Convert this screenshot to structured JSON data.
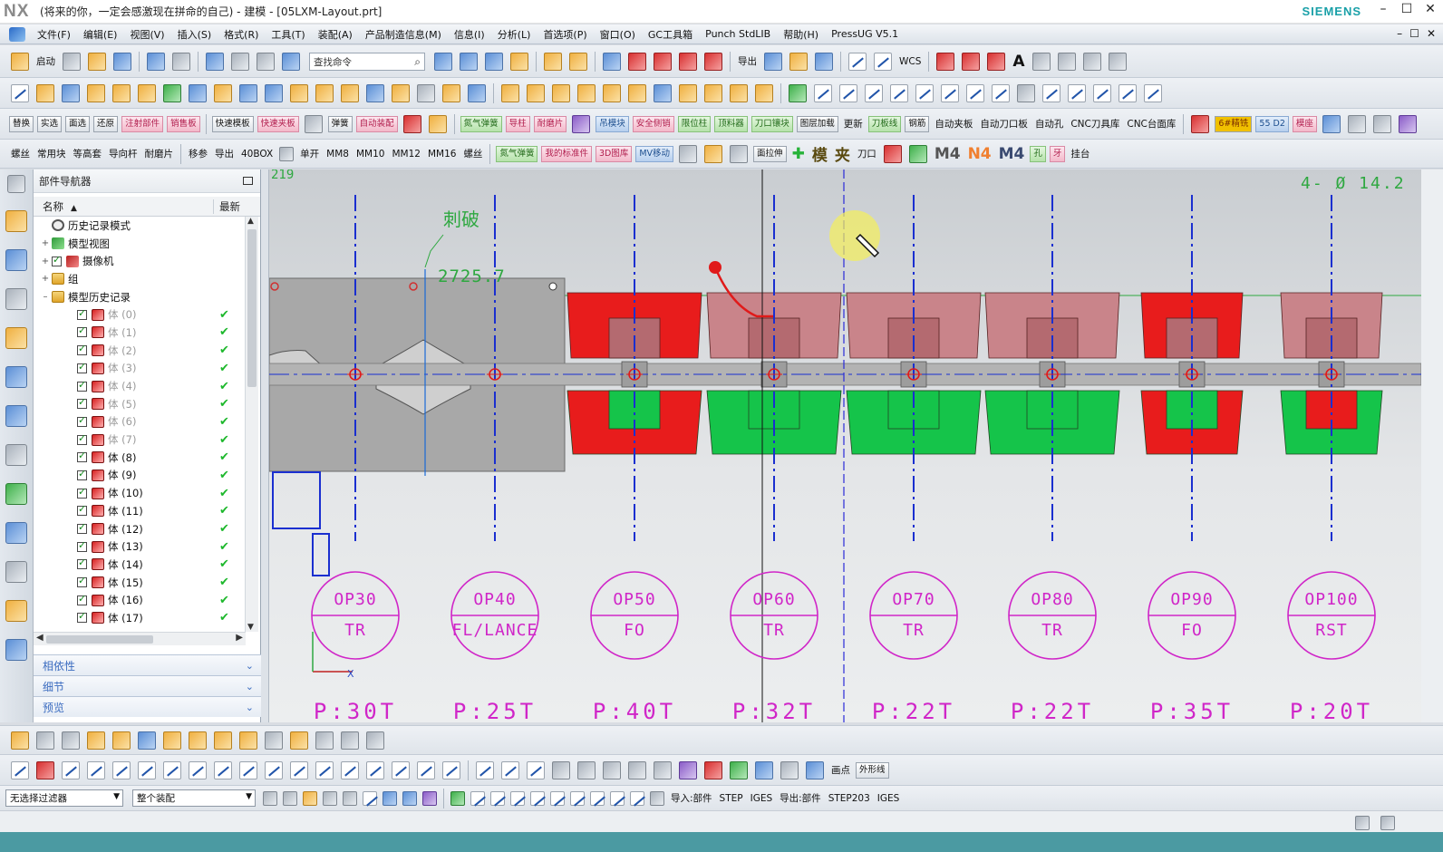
{
  "window": {
    "app_logo": "NX",
    "title": "(将来的你，一定会感激现在拼命的自己) - 建模 - [05LXM-Layout.prt]",
    "brand": "SIEMENS",
    "controls": [
      "–",
      "☐",
      "✕"
    ]
  },
  "menu": {
    "items": [
      "文件(F)",
      "编辑(E)",
      "视图(V)",
      "插入(S)",
      "格式(R)",
      "工具(T)",
      "装配(A)",
      "产品制造信息(M)",
      "信息(I)",
      "分析(L)",
      "首选项(P)",
      "窗口(O)",
      "GC工具箱",
      "Punch StdLIB",
      "帮助(H)",
      "PressUG V5.1"
    ],
    "right_controls": [
      "–",
      "☐",
      "✕"
    ]
  },
  "toolbar1": {
    "start_label": "启动",
    "search_placeholder": "查找命令",
    "export_label": "导出",
    "wcs_label": "WCS"
  },
  "toolbar3": {
    "labels": [
      "替换",
      "实选",
      "面选",
      "还原",
      "注射部件",
      "销售板",
      "快速模板",
      "快速夹板",
      "弹簧",
      "自动装配",
      "氮气弹簧",
      "导柱",
      "耐磨片",
      "吊模块",
      "安全侧销",
      "限位柱",
      "顶料器",
      "刀口镶块",
      "图层加载",
      "更新",
      "刀板线",
      "钢筋",
      "自动夹板",
      "自动刀口板",
      "自动孔",
      "CNC刀具库",
      "CNC台面库"
    ],
    "chips": [
      "6#精铣",
      "55 D2",
      "模座"
    ]
  },
  "toolbar4": {
    "labels": [
      "螺丝",
      "常用块",
      "等高套",
      "导向杆",
      "耐磨片",
      "移参",
      "导出",
      "40BOX",
      "单开",
      "MM8",
      "MM10",
      "MM12",
      "MM16",
      "螺丝",
      "氮气弹簧",
      "我的标准件",
      "3D图库",
      "MV移动",
      "面拉伸",
      "模",
      "夹",
      "刀口",
      "M4",
      "N4",
      "M4",
      "孔",
      "牙",
      "挂台"
    ]
  },
  "navigator": {
    "title": "部件导航器",
    "col_name": "名称",
    "col_latest": "最新",
    "tree": [
      {
        "label": "历史记录模式",
        "icon": "clock-icon",
        "indent": 0,
        "expander": "",
        "checkbox": false,
        "grey": false,
        "ok": false
      },
      {
        "label": "模型视图",
        "icon": "model-view-icon",
        "indent": 0,
        "expander": "+",
        "checkbox": false,
        "grey": false,
        "ok": false
      },
      {
        "label": "摄像机",
        "icon": "camera-icon",
        "indent": 0,
        "expander": "+",
        "checkbox": true,
        "grey": false,
        "ok": false
      },
      {
        "label": "组",
        "icon": "folder-icon",
        "indent": 0,
        "expander": "+",
        "checkbox": false,
        "grey": false,
        "ok": false
      },
      {
        "label": "模型历史记录",
        "icon": "folder-icon",
        "indent": 0,
        "expander": "–",
        "checkbox": false,
        "grey": false,
        "ok": false
      },
      {
        "label": "体 (0)",
        "icon": "body-icon",
        "indent": 1,
        "expander": "",
        "checkbox": true,
        "grey": true,
        "ok": true
      },
      {
        "label": "体 (1)",
        "icon": "body-icon",
        "indent": 1,
        "expander": "",
        "checkbox": true,
        "grey": true,
        "ok": true
      },
      {
        "label": "体 (2)",
        "icon": "body-icon",
        "indent": 1,
        "expander": "",
        "checkbox": true,
        "grey": true,
        "ok": true
      },
      {
        "label": "体 (3)",
        "icon": "body-icon",
        "indent": 1,
        "expander": "",
        "checkbox": true,
        "grey": true,
        "ok": true
      },
      {
        "label": "体 (4)",
        "icon": "body-icon",
        "indent": 1,
        "expander": "",
        "checkbox": true,
        "grey": true,
        "ok": true
      },
      {
        "label": "体 (5)",
        "icon": "body-icon",
        "indent": 1,
        "expander": "",
        "checkbox": true,
        "grey": true,
        "ok": true
      },
      {
        "label": "体 (6)",
        "icon": "body-icon",
        "indent": 1,
        "expander": "",
        "checkbox": true,
        "grey": true,
        "ok": true
      },
      {
        "label": "体 (7)",
        "icon": "body-icon",
        "indent": 1,
        "expander": "",
        "checkbox": true,
        "grey": true,
        "ok": true
      },
      {
        "label": "体 (8)",
        "icon": "body-icon",
        "indent": 1,
        "expander": "",
        "checkbox": true,
        "grey": false,
        "ok": true
      },
      {
        "label": "体 (9)",
        "icon": "body-icon",
        "indent": 1,
        "expander": "",
        "checkbox": true,
        "grey": false,
        "ok": true
      },
      {
        "label": "体 (10)",
        "icon": "body-icon",
        "indent": 1,
        "expander": "",
        "checkbox": true,
        "grey": false,
        "ok": true
      },
      {
        "label": "体 (11)",
        "icon": "body-icon",
        "indent": 1,
        "expander": "",
        "checkbox": true,
        "grey": false,
        "ok": true
      },
      {
        "label": "体 (12)",
        "icon": "body-icon",
        "indent": 1,
        "expander": "",
        "checkbox": true,
        "grey": false,
        "ok": true
      },
      {
        "label": "体 (13)",
        "icon": "body-icon",
        "indent": 1,
        "expander": "",
        "checkbox": true,
        "grey": false,
        "ok": true
      },
      {
        "label": "体 (14)",
        "icon": "body-icon",
        "indent": 1,
        "expander": "",
        "checkbox": true,
        "grey": false,
        "ok": true
      },
      {
        "label": "体 (15)",
        "icon": "body-icon",
        "indent": 1,
        "expander": "",
        "checkbox": true,
        "grey": false,
        "ok": true
      },
      {
        "label": "体 (16)",
        "icon": "body-icon",
        "indent": 1,
        "expander": "",
        "checkbox": true,
        "grey": false,
        "ok": true
      },
      {
        "label": "体 (17)",
        "icon": "body-icon",
        "indent": 1,
        "expander": "",
        "checkbox": true,
        "grey": false,
        "ok": true
      }
    ],
    "panels": [
      "相依性",
      "细节",
      "预览"
    ]
  },
  "graphics": {
    "annotation": "刺破",
    "dimension": "2725.7",
    "hole_note": "4- Ø 14.2",
    "top_left_number": "219",
    "axis_x_label": "X",
    "stations": [
      {
        "op": "OP30",
        "code": "TR",
        "tonnage": "P:30T"
      },
      {
        "op": "OP40",
        "code": "FL/LANCE",
        "tonnage": "P:25T"
      },
      {
        "op": "OP50",
        "code": "FO",
        "tonnage": "P:40T"
      },
      {
        "op": "OP60",
        "code": "TR",
        "tonnage": "P:32T"
      },
      {
        "op": "OP70",
        "code": "TR",
        "tonnage": "P:22T"
      },
      {
        "op": "OP80",
        "code": "TR",
        "tonnage": "P:22T"
      },
      {
        "op": "OP90",
        "code": "FO",
        "tonnage": "P:35T"
      },
      {
        "op": "OP100",
        "code": "RST",
        "tonnage": "P:20T"
      }
    ],
    "colors": {
      "station_circle": "#d026c8",
      "centerline": "#1a2fd0",
      "die_red": "#e81c1c",
      "die_green": "#15c44a",
      "die_pink": "#c9848a",
      "strip_grey": "#a8a8a8"
    }
  },
  "bottom": {
    "filter_label": "无选择过滤器",
    "assembly_label": "整个装配",
    "point_label": "画点",
    "outline_label": "外形线",
    "import_label": "导入:部件",
    "import_step": "STEP",
    "import_iges": "IGES",
    "export_label": "导出:部件",
    "export_step": "STEP203",
    "export_iges": "IGES"
  }
}
